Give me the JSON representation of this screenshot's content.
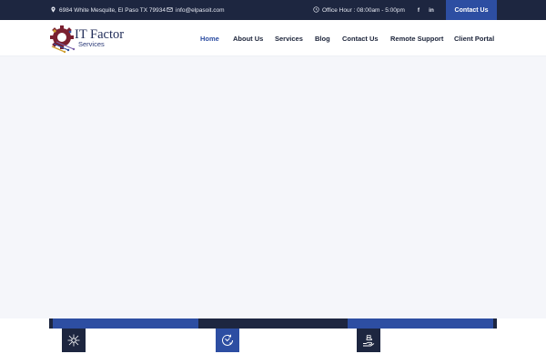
{
  "colors": {
    "topbar_bg": "#1d2640",
    "accent": "#2d4ea2",
    "hero_bg": "#f5f6fa",
    "nav_active": "#2d4ea2",
    "nav_text": "#1a2238"
  },
  "topbar": {
    "address": "6984 White Mesquite, El Paso TX 79934",
    "address_icon": "map-pin-icon",
    "email": "info@elpasoit.com",
    "email_icon": "envelope-icon",
    "office_hours": "Office Hour : 08:00am - 5:00pm",
    "clock_icon": "clock-icon",
    "social": [
      {
        "icon": "facebook-icon",
        "glyph": "f"
      },
      {
        "icon": "linkedin-icon",
        "glyph": "in"
      }
    ],
    "cta_label": "Contact Us"
  },
  "header": {
    "logo": {
      "title": "IT Factor",
      "subtitle": "Services",
      "icon": "gear-circuit-logo-icon"
    },
    "nav": [
      {
        "label": "Home",
        "active": true
      },
      {
        "label": "About Us",
        "active": false
      },
      {
        "label": "Services",
        "active": false
      },
      {
        "label": "Blog",
        "active": false
      },
      {
        "label": "Contact Us",
        "active": false
      },
      {
        "label": "Remote Support",
        "active": false
      },
      {
        "label": "Client Portal",
        "active": false
      }
    ]
  },
  "feature_icons": [
    {
      "icon": "network-hub-icon"
    },
    {
      "icon": "support-24-icon"
    },
    {
      "icon": "hand-cloud-icon"
    }
  ]
}
